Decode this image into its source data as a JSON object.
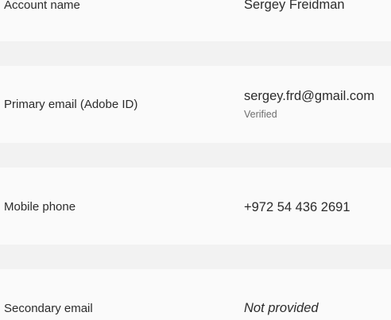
{
  "account_info": {
    "rows": [
      {
        "label": "Account name",
        "value": "Sergey Freidman"
      },
      {
        "label": "Primary email (Adobe ID)",
        "value": "sergey.frd@gmail.com",
        "status": "Verified"
      },
      {
        "label": "Mobile phone",
        "value": "+972 54 436 2691"
      },
      {
        "label": "Secondary email",
        "value": "Not provided"
      }
    ]
  },
  "colors": {
    "row_background": "#fafafa",
    "page_background": "#f2f2f2",
    "text": "#2c2c2c",
    "muted_text": "#6e6e6e"
  }
}
